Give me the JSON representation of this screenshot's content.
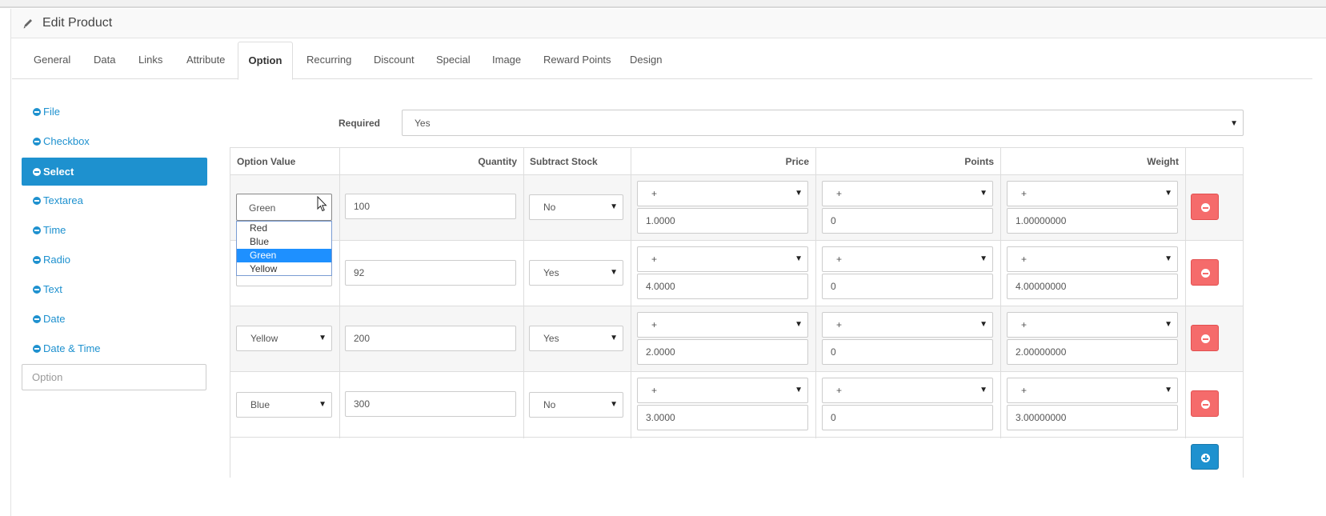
{
  "header": {
    "title": "Edit Product"
  },
  "tabs": [
    {
      "label": "General"
    },
    {
      "label": "Data"
    },
    {
      "label": "Links"
    },
    {
      "label": "Attribute"
    },
    {
      "label": "Option"
    },
    {
      "label": "Recurring"
    },
    {
      "label": "Discount"
    },
    {
      "label": "Special"
    },
    {
      "label": "Image"
    },
    {
      "label": "Reward Points"
    },
    {
      "label": "Design"
    }
  ],
  "active_tab": "Option",
  "sidebar": {
    "items": [
      {
        "label": "File"
      },
      {
        "label": "Checkbox"
      },
      {
        "label": "Select"
      },
      {
        "label": "Textarea"
      },
      {
        "label": "Time"
      },
      {
        "label": "Radio"
      },
      {
        "label": "Text"
      },
      {
        "label": "Date"
      },
      {
        "label": "Date & Time"
      }
    ],
    "active": "Select",
    "option_placeholder": "Option"
  },
  "required": {
    "label": "Required",
    "value": "Yes"
  },
  "table": {
    "headers": {
      "option_value": "Option Value",
      "quantity": "Quantity",
      "subtract": "Subtract Stock",
      "price": "Price",
      "points": "Points",
      "weight": "Weight"
    },
    "rows": [
      {
        "option_value": "Green",
        "quantity": "100",
        "subtract": "No",
        "price_prefix": "+",
        "price": "1.0000",
        "points_prefix": "+",
        "points": "0",
        "weight_prefix": "+",
        "weight": "1.00000000"
      },
      {
        "option_value": "",
        "quantity": "92",
        "subtract": "Yes",
        "price_prefix": "+",
        "price": "4.0000",
        "points_prefix": "+",
        "points": "0",
        "weight_prefix": "+",
        "weight": "4.00000000"
      },
      {
        "option_value": "Yellow",
        "quantity": "200",
        "subtract": "Yes",
        "price_prefix": "+",
        "price": "2.0000",
        "points_prefix": "+",
        "points": "0",
        "weight_prefix": "+",
        "weight": "2.00000000"
      },
      {
        "option_value": "Blue",
        "quantity": "300",
        "subtract": "No",
        "price_prefix": "+",
        "price": "3.0000",
        "points_prefix": "+",
        "points": "0",
        "weight_prefix": "+",
        "weight": "3.00000000"
      }
    ]
  },
  "dropdown": {
    "options": [
      "Red",
      "Blue",
      "Green",
      "Yellow"
    ],
    "selected": "Green"
  },
  "icons": {
    "caret": "▼",
    "header_icon": "pencil-icon",
    "remove": "minus-circle-icon",
    "add": "plus-circle-icon"
  },
  "colors": {
    "primary": "#1e91cf",
    "danger": "#f56b6b",
    "dropdown_selected": "#1e90ff"
  }
}
